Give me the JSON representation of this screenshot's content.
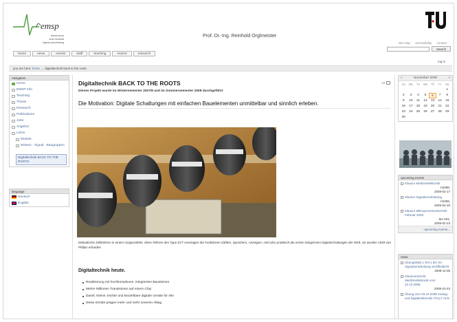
{
  "header": {
    "logo_text": "emsp",
    "logo_subtitle": [
      "electronics",
      "and medical",
      "signal processing"
    ],
    "prof_name": "Prof. Dr.-Ing. Reinhold Orglmeister",
    "top_links": [
      "site map",
      "accessibility",
      "contact"
    ],
    "search_button": "Search",
    "login": "log in",
    "tabs": [
      "home",
      "news",
      "events",
      "staff",
      "teaching",
      "exams",
      "research"
    ]
  },
  "breadcrumb": {
    "prefix": "you are here:",
    "home": "home",
    "sep": "→",
    "current": "digitaltechnik back to the roots"
  },
  "navigation": {
    "title": "navigation",
    "items": [
      "Home",
      "EMSP Info",
      "Teaching",
      "Thesis",
      "Research",
      "Publications",
      "Jobs",
      "Angebot",
      "Lehre",
      "Module",
      "Wissen - Signal - Baugruppen"
    ],
    "active": "Digitaltechnik BACK TO THE ROOTS"
  },
  "language": {
    "title": "language",
    "items": [
      "Deutsch",
      "English"
    ]
  },
  "content": {
    "title": "Digitaltechnik BACK TO THE ROOTS",
    "page_num": "18",
    "subline": "Dieses Projekt wurde im Wintersemester 2007/8 und im Sommersemester 2008 durchgeführt",
    "motivation": "Die Motivation: Digitale Schaltungen mit einfachen Bauelementen unmittelbar und sinnlich erleben.",
    "caption": "Dekadische Zählröhren in einem Geigerzähler, diese Röhren des Type E1T vereinigen die Funktionen Zählen, Speichern, Anzeigen, sind also praktisch die ersten integrierten Digitalschaltungen der Welt, sie wurden 1949 von Philips erfunden",
    "section_head": "Digitaltechnik heute.",
    "bullets": [
      "Realisierung mit hochkomplexen, integrierten Bausteinen",
      "Mehre Millionen Transistoren auf einem Chip",
      "Damit: Kleine, leichte und bezahlbare digitale Geräte für Alle",
      "Diese Geräte prägen mehr und mehr unseren Alltag"
    ]
  },
  "calendar": {
    "prev": "«",
    "title": "November 2008",
    "next": "»",
    "dow": [
      "Su",
      "Mo",
      "Tu",
      "We",
      "Th",
      "Fr",
      "Sa"
    ],
    "days": [
      "",
      "",
      "",
      "",
      "",
      "",
      "1",
      "2",
      "3",
      "4",
      "5",
      "6",
      "7",
      "8",
      "9",
      "10",
      "11",
      "12",
      "13",
      "14",
      "15",
      "16",
      "17",
      "18",
      "19",
      "20",
      "21",
      "22",
      "23",
      "24",
      "25",
      "26",
      "27",
      "28",
      "29",
      "30",
      "",
      "",
      "",
      "",
      "",
      ""
    ],
    "today": "6"
  },
  "events": {
    "title": "upcoming events",
    "items": [
      {
        "name": "Klausur Medizinelektronik",
        "room": "H1058,",
        "date": "2009-02-17"
      },
      {
        "name": "Klausur Signalverarbeitung",
        "room": "H1058,",
        "date": "2009-02-19"
      },
      {
        "name": "Klausur Mikroprozessortechnik Februar 2009",
        "room": "MA 001,",
        "date": "2009-02-23"
      }
    ],
    "more": "Upcoming events..."
  },
  "news": {
    "title": "news",
    "items": [
      {
        "name": "Übungsblatt 1 Teil 1 der SV Signalverarbeitung veröffentlicht",
        "date": "2008-11-05"
      },
      {
        "name": "Klausureinsicht Medizinelektronik vom 22.10.2008",
        "date": "2008-10-23"
      },
      {
        "name": "Übung vom 03.10.2008 Analog- und Digitalelektronik FÄLLT AUS",
        "date": ""
      }
    ]
  }
}
